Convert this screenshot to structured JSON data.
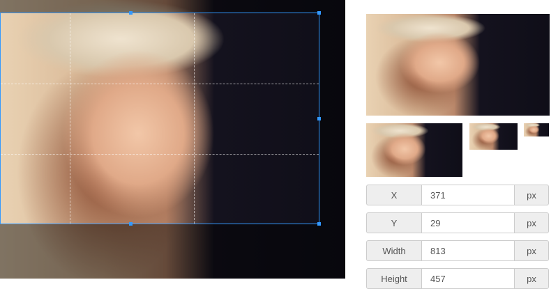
{
  "fields": [
    {
      "label": "X",
      "value": "371",
      "unit": "px"
    },
    {
      "label": "Y",
      "value": "29",
      "unit": "px"
    },
    {
      "label": "Width",
      "value": "813",
      "unit": "px"
    },
    {
      "label": "Height",
      "value": "457",
      "unit": "px"
    }
  ],
  "colors": {
    "accent": "#3399ff"
  }
}
